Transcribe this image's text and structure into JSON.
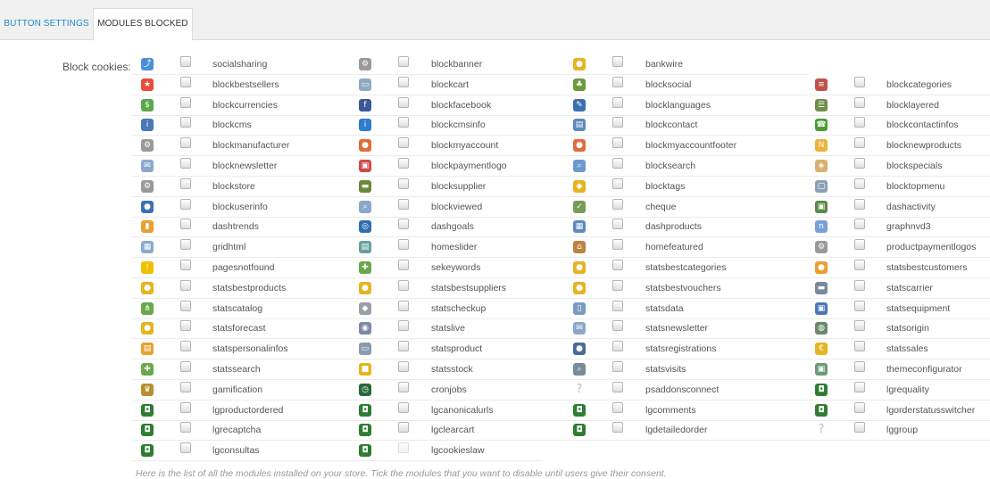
{
  "tabs": [
    {
      "label": "BUTTON SETTINGS",
      "active": false
    },
    {
      "label": "MODULES BLOCKED",
      "active": true
    }
  ],
  "form": {
    "label": "Block cookies:",
    "help": "Here is the list of all the modules installed on your store. Tick the modules that you want to disable until users give their consent."
  },
  "modules": [
    {
      "name": "socialsharing",
      "icon": "share-icon",
      "color": "#4a90d9"
    },
    {
      "name": "blockbanner",
      "icon": "gear-icon",
      "color": "#9a9a9a"
    },
    {
      "name": "bankwire",
      "icon": "coins-icon",
      "color": "#e6b422"
    },
    {
      "name": "blockbestsellers",
      "icon": "star-icon",
      "color": "#e84c3d"
    },
    {
      "name": "blockcart",
      "icon": "basket-icon",
      "color": "#8fa9c4"
    },
    {
      "name": "blocksocial",
      "icon": "people-icon",
      "color": "#6b9b3a"
    },
    {
      "name": "blockcategories",
      "icon": "list-icon",
      "color": "#c0524a"
    },
    {
      "name": "blockcurrencies",
      "icon": "money-icon",
      "color": "#5aa84a"
    },
    {
      "name": "blockfacebook",
      "icon": "facebook-icon",
      "color": "#3b5998"
    },
    {
      "name": "blocklanguages",
      "icon": "chat-icon",
      "color": "#3a70b0"
    },
    {
      "name": "blocklayered",
      "icon": "filter-icon",
      "color": "#6e8e4a"
    },
    {
      "name": "blockcms",
      "icon": "info-icon",
      "color": "#4a78b8"
    },
    {
      "name": "blockcmsinfo",
      "icon": "info-icon",
      "color": "#2f7bd0"
    },
    {
      "name": "blockcontact",
      "icon": "contact-card-icon",
      "color": "#5d8ac0"
    },
    {
      "name": "blockcontactinfos",
      "icon": "phone-icon",
      "color": "#4a9e3a"
    },
    {
      "name": "blockmanufacturer",
      "icon": "gear-icon",
      "color": "#9a9a9a"
    },
    {
      "name": "blockmyaccount",
      "icon": "user-icon",
      "color": "#e06c3c"
    },
    {
      "name": "blockmyaccountfooter",
      "icon": "user-icon",
      "color": "#e06c3c"
    },
    {
      "name": "blocknewproducts",
      "icon": "new-badge-icon",
      "color": "#e8b43a"
    },
    {
      "name": "blocknewsletter",
      "icon": "envelope-icon",
      "color": "#8aa8cc"
    },
    {
      "name": "blockpaymentlogo",
      "icon": "payment-icon",
      "color": "#d04a4a"
    },
    {
      "name": "blocksearch",
      "icon": "magnifier-icon",
      "color": "#6a9ad0"
    },
    {
      "name": "blockspecials",
      "icon": "tag-icon",
      "color": "#d8b070"
    },
    {
      "name": "blockstore",
      "icon": "gear-icon",
      "color": "#9a9a9a"
    },
    {
      "name": "blocksupplier",
      "icon": "truck-icon",
      "color": "#6b8a3a"
    },
    {
      "name": "blocktags",
      "icon": "tags-icon",
      "color": "#e6b422"
    },
    {
      "name": "blocktopmenu",
      "icon": "window-icon",
      "color": "#8aa0b8"
    },
    {
      "name": "blockuserinfo",
      "icon": "user-icon",
      "color": "#3a70b0"
    },
    {
      "name": "blockviewed",
      "icon": "document-search-icon",
      "color": "#8aa8cc"
    },
    {
      "name": "cheque",
      "icon": "cheque-icon",
      "color": "#7a9a5a"
    },
    {
      "name": "dashactivity",
      "icon": "monitor-icon",
      "color": "#5a8a4a"
    },
    {
      "name": "dashtrends",
      "icon": "bar-chart-icon",
      "color": "#e8a030"
    },
    {
      "name": "dashgoals",
      "icon": "target-icon",
      "color": "#2f6fb0"
    },
    {
      "name": "dashproducts",
      "icon": "table-icon",
      "color": "#5d8ac0"
    },
    {
      "name": "graphnvd3",
      "icon": "nvd3-icon",
      "color": "#7aa0d8"
    },
    {
      "name": "gridhtml",
      "icon": "grid-icon",
      "color": "#8aa8cc"
    },
    {
      "name": "homeslider",
      "icon": "slider-icon",
      "color": "#6aa0a0"
    },
    {
      "name": "homefeatured",
      "icon": "home-icon",
      "color": "#c08040"
    },
    {
      "name": "productpaymentlogos",
      "icon": "gear-icon",
      "color": "#9a9a9a"
    },
    {
      "name": "pagesnotfound",
      "icon": "warning-icon",
      "color": "#f0c000"
    },
    {
      "name": "sekeywords",
      "icon": "puzzle-icon",
      "color": "#6aa84a"
    },
    {
      "name": "statsbestcategories",
      "icon": "medal-icon",
      "color": "#e6b422"
    },
    {
      "name": "statsbestcustomers",
      "icon": "user-icon",
      "color": "#e8a030"
    },
    {
      "name": "statsbestproducts",
      "icon": "medal-icon",
      "color": "#e6b422"
    },
    {
      "name": "statsbestsuppliers",
      "icon": "medal-icon",
      "color": "#e6b422"
    },
    {
      "name": "statsbestvouchers",
      "icon": "medal-icon",
      "color": "#e6b422"
    },
    {
      "name": "statscarrier",
      "icon": "truck-icon",
      "color": "#7a8a9a"
    },
    {
      "name": "statscatalog",
      "icon": "sitemap-icon",
      "color": "#6aa84a"
    },
    {
      "name": "statscheckup",
      "icon": "cube-icon",
      "color": "#9aa0a8"
    },
    {
      "name": "statsdata",
      "icon": "document-icon",
      "color": "#7a9ac0"
    },
    {
      "name": "statsequipment",
      "icon": "tv-icon",
      "color": "#4a78b8"
    },
    {
      "name": "statsforecast",
      "icon": "coins-icon",
      "color": "#e6b422"
    },
    {
      "name": "statslive",
      "icon": "eye-icon",
      "color": "#7a8aa8"
    },
    {
      "name": "statsnewsletter",
      "icon": "envelope-icon",
      "color": "#8aa8cc"
    },
    {
      "name": "statsorigin",
      "icon": "globe-icon",
      "color": "#6a8a6a"
    },
    {
      "name": "statspersonalinfos",
      "icon": "contact-folder-icon",
      "color": "#e8a030"
    },
    {
      "name": "statsproduct",
      "icon": "printer-icon",
      "color": "#8a9ab0"
    },
    {
      "name": "statsregistrations",
      "icon": "user-icon",
      "color": "#4a6a9a"
    },
    {
      "name": "statssales",
      "icon": "euro-icon",
      "color": "#e6b422"
    },
    {
      "name": "statssearch",
      "icon": "puzzle-icon",
      "color": "#6aa84a"
    },
    {
      "name": "statsstock",
      "icon": "box-icon",
      "color": "#e6b422"
    },
    {
      "name": "statsvisits",
      "icon": "user-search-icon",
      "color": "#7a8a9a"
    },
    {
      "name": "themeconfigurator",
      "icon": "picture-icon",
      "color": "#6a9a7a"
    },
    {
      "name": "gamification",
      "icon": "trophy-icon",
      "color": "#b89030"
    },
    {
      "name": "cronjobs",
      "icon": "clock-icon",
      "color": "#2a6a3a"
    },
    {
      "name": "psaddonsconnect",
      "icon": "question-icon",
      "color": "#c8c8c8"
    },
    {
      "name": "lgrequality",
      "icon": "lg-icon",
      "color": "#2e7d32"
    },
    {
      "name": "lgproductordered",
      "icon": "lg-icon",
      "color": "#2e7d32"
    },
    {
      "name": "lgcanonicalurls",
      "icon": "lg-icon",
      "color": "#2e7d32"
    },
    {
      "name": "lgcomments",
      "icon": "lg-icon",
      "color": "#2e7d32"
    },
    {
      "name": "lgorderstatusswitcher",
      "icon": "lg-icon",
      "color": "#2e7d32"
    },
    {
      "name": "lgrecaptcha",
      "icon": "lg-icon",
      "color": "#2e7d32"
    },
    {
      "name": "lgclearcart",
      "icon": "lg-icon",
      "color": "#2e7d32"
    },
    {
      "name": "lgdetailedorder",
      "icon": "lg-icon",
      "color": "#2e7d32"
    },
    {
      "name": "lggroup",
      "icon": "question-icon",
      "color": "#c8c8c8"
    },
    {
      "name": "lgconsultas",
      "icon": "lg-icon",
      "color": "#2e7d32"
    },
    {
      "name": "lgcookieslaw",
      "icon": "lg-icon",
      "color": "#2e7d32",
      "disabled": true
    }
  ]
}
